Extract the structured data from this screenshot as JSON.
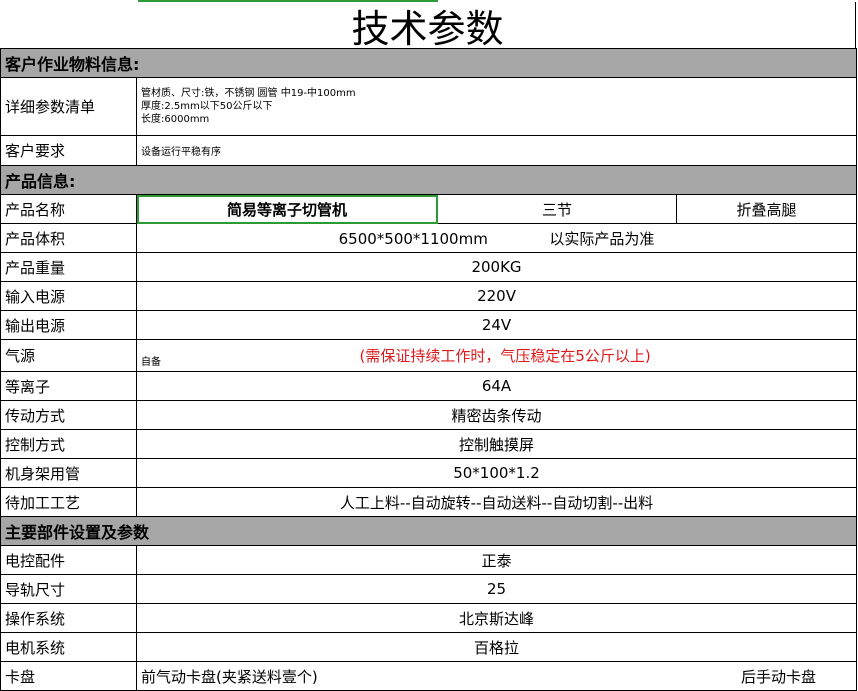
{
  "title": "技术参数",
  "sections": {
    "customer": "客户作业物料信息:",
    "product": "产品信息:",
    "parts": "主要部件设置及参数"
  },
  "customer": {
    "detail_label": "详细参数清单",
    "detail_lines": [
      "管材质、尺寸:铁，不锈钢 圆管 中19-中100mm",
      "厚度:2.5mm以下50公斤以下",
      "长度:6000mm"
    ],
    "req_label": "客户要求",
    "req_value": "设备运行平稳有序"
  },
  "product": {
    "name_label": "产品名称",
    "name_value": "简易等离子切管机",
    "name_opt1": "三节",
    "name_opt2": "折叠高腿",
    "volume_label": "产品体积",
    "volume_value": "6500*500*1100mm",
    "volume_note": "以实际产品为准",
    "weight_label": "产品重量",
    "weight_value": "200KG",
    "input_label": "输入电源",
    "input_value": "220V",
    "output_label": "输出电源",
    "output_value": "24V",
    "air_label": "气源",
    "air_value": "自备",
    "air_note": "(需保证持续工作时，气压稳定在5公斤以上)",
    "plasma_label": "等离子",
    "plasma_value": "64A",
    "drive_label": "传动方式",
    "drive_value": "精密齿条传动",
    "control_label": "控制方式",
    "control_value": "控制触摸屏",
    "frame_label": "机身架用管",
    "frame_value": "50*100*1.2",
    "process_label": "待加工工艺",
    "process_value": "人工上料--自动旋转--自动送料--自动切割--出料"
  },
  "parts": {
    "elec_label": "电控配件",
    "elec_value": "正泰",
    "rail_label": "导轨尺寸",
    "rail_value": "25",
    "os_label": "操作系统",
    "os_value": "北京斯达峰",
    "motor_label": "电机系统",
    "motor_value": "百格拉",
    "chuck_label": "卡盘",
    "chuck_front": "前气动卡盘(夹紧送料壹个)",
    "chuck_rear": "后手动卡盘"
  },
  "colors": {
    "section_bg": "#a6a6a6",
    "selection": "#2e9a36",
    "note_red": "#e0191b"
  }
}
